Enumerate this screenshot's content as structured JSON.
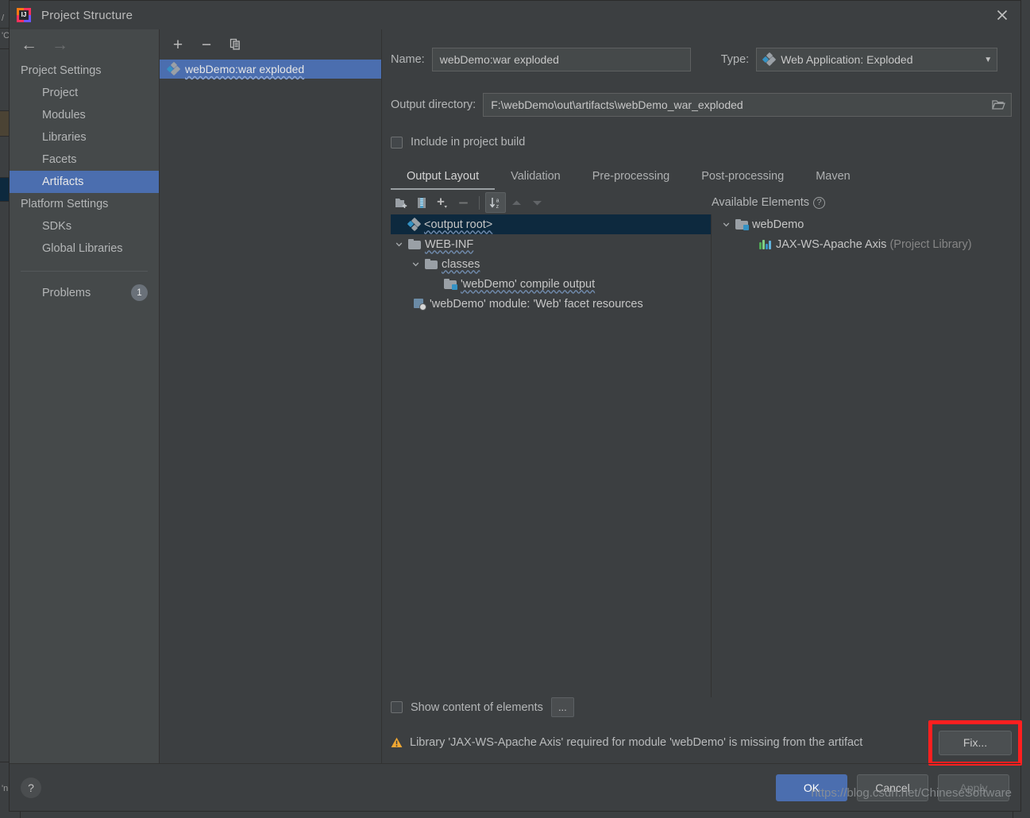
{
  "window": {
    "title": "Project Structure",
    "app_icon": "intellij-idea-icon",
    "close_icon": "close-icon"
  },
  "background": {
    "left_labels": [
      "/",
      "'C",
      "'n"
    ],
    "accent": "#3c3f41"
  },
  "sidebar": {
    "back_icon": "arrow-left-icon",
    "forward_icon": "arrow-right-icon",
    "groups": [
      {
        "label": "Project Settings",
        "items": [
          {
            "label": "Project",
            "selected": false
          },
          {
            "label": "Modules",
            "selected": false
          },
          {
            "label": "Libraries",
            "selected": false
          },
          {
            "label": "Facets",
            "selected": false
          },
          {
            "label": "Artifacts",
            "selected": true
          }
        ]
      },
      {
        "label": "Platform Settings",
        "items": [
          {
            "label": "SDKs",
            "selected": false
          },
          {
            "label": "Global Libraries",
            "selected": false
          }
        ]
      }
    ],
    "problems": {
      "label": "Problems",
      "count": "1"
    }
  },
  "artifacts_pane": {
    "toolbar": [
      {
        "name": "add-artifact-button",
        "icon": "plus-icon",
        "label": "+"
      },
      {
        "name": "remove-artifact-button",
        "icon": "minus-icon",
        "label": "−"
      },
      {
        "name": "copy-artifact-button",
        "icon": "copy-icon",
        "label": ""
      }
    ],
    "items": [
      {
        "label": "webDemo:war exploded",
        "icon": "artifact-icon",
        "selected": true
      }
    ]
  },
  "form": {
    "name_label": "Name:",
    "name_value": "webDemo:war exploded",
    "type_label": "Type:",
    "type_value": "Web Application: Exploded",
    "type_icon": "artifact-icon",
    "type_caret": "chevron-down-icon",
    "output_label": "Output directory:",
    "output_value": "F:\\webDemo\\out\\artifacts\\webDemo_war_exploded",
    "browse_icon": "folder-open-icon",
    "include_in_build": {
      "label": "Include in project build",
      "checked": false
    }
  },
  "tabs": [
    {
      "label": "Output Layout",
      "active": true
    },
    {
      "label": "Validation",
      "active": false
    },
    {
      "label": "Pre-processing",
      "active": false
    },
    {
      "label": "Post-processing",
      "active": false
    },
    {
      "label": "Maven",
      "active": false
    }
  ],
  "content_toolbar": {
    "buttons": [
      {
        "name": "create-directory-button",
        "icon": "new-folder-icon",
        "active": false,
        "disabled": false
      },
      {
        "name": "create-archive-button",
        "icon": "archive-icon",
        "active": false,
        "disabled": false
      },
      {
        "name": "add-copy-of-button",
        "icon": "plus-dropdown-icon",
        "active": false,
        "disabled": false
      },
      {
        "name": "remove-element-button",
        "icon": "minus-icon",
        "active": false,
        "disabled": true
      },
      {
        "name": "sort-alphabetically-button",
        "icon": "sort-az-icon",
        "active": true,
        "disabled": false
      },
      {
        "name": "move-up-button",
        "icon": "arrow-up-icon",
        "active": false,
        "disabled": true
      },
      {
        "name": "move-down-button",
        "icon": "arrow-down-icon",
        "active": false,
        "disabled": true
      }
    ],
    "available_elements_label": "Available Elements",
    "help_icon": "help-circle-icon"
  },
  "output_tree": [
    {
      "label": "<output root>",
      "icon": "artifact-icon",
      "indent": 0,
      "selected": true,
      "twisty": "none",
      "squiggle": true
    },
    {
      "label": "WEB-INF",
      "icon": "folder-icon",
      "indent": 1,
      "selected": false,
      "twisty": "expanded",
      "squiggle": true
    },
    {
      "label": "classes",
      "icon": "folder-icon",
      "indent": 2,
      "selected": false,
      "twisty": "expanded",
      "squiggle": true
    },
    {
      "label": "'webDemo' compile output",
      "icon": "compile-output-icon",
      "indent": 3,
      "selected": false,
      "twisty": "none",
      "squiggle": true
    },
    {
      "label": "'webDemo' module: 'Web' facet resources",
      "icon": "facet-icon",
      "indent": 2,
      "selected": false,
      "twisty": "none",
      "squiggle": false
    }
  ],
  "available_tree": [
    {
      "label": "webDemo",
      "suffix": "",
      "icon": "module-icon",
      "indent": 0,
      "twisty": "expanded"
    },
    {
      "label": "JAX-WS-Apache Axis",
      "suffix": " (Project Library)",
      "icon": "library-icon",
      "indent": 1,
      "twisty": "none"
    }
  ],
  "bottom": {
    "show_content": {
      "label": "Show content of elements",
      "checked": false
    },
    "ellipsis_button": "...",
    "warning_icon": "warning-triangle-icon",
    "warning_text": "Library 'JAX-WS-Apache Axis' required for module 'webDemo' is missing from the artifact",
    "fix_button": "Fix...",
    "fix_highlight_color": "#ff1f1f"
  },
  "footer": {
    "help_button": "?",
    "buttons": [
      {
        "label": "OK",
        "style": "primary",
        "disabled": false
      },
      {
        "label": "Cancel",
        "style": "default",
        "disabled": false
      },
      {
        "label": "Apply",
        "style": "default",
        "disabled": true
      }
    ]
  },
  "watermark": "https://blog.csdn.net/ChineseSoftware"
}
